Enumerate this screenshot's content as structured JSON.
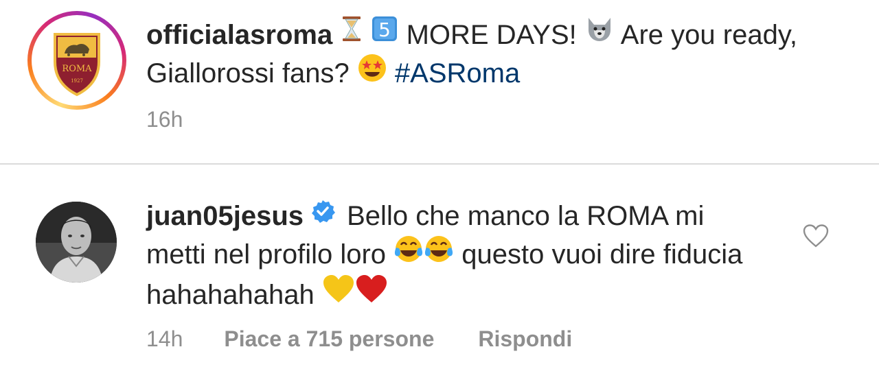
{
  "post": {
    "username": "officialasroma",
    "caption_text_1": " MORE DAYS! ",
    "caption_text_2": " Are you ready, Giallorossi fans? ",
    "hashtag": "#ASRoma",
    "timestamp": "16h",
    "avatar_logo_text": "ROMA",
    "avatar_logo_year": "1927",
    "emojis": [
      "hourglass-icon",
      "keycap-5-icon",
      "wolf-icon",
      "star-struck-icon"
    ]
  },
  "comment": {
    "username": "juan05jesus",
    "text_1": " Bello che manco la ROMA mi metti nel profilo loro ",
    "text_2": " questo vuoi dire fiducia hahahahahah ",
    "timestamp": "14h",
    "likes_label": "Piace a 715 persone",
    "reply_label": "Rispondi",
    "verified": true,
    "emojis": [
      "tears-of-joy-icon",
      "tears-of-joy-icon",
      "yellow-heart-icon",
      "red-heart-icon"
    ]
  },
  "colors": {
    "text": "#262626",
    "meta": "#8e8e8e",
    "hashtag": "#00376b",
    "verified": "#3897f0",
    "divider": "#dbdbdb"
  }
}
